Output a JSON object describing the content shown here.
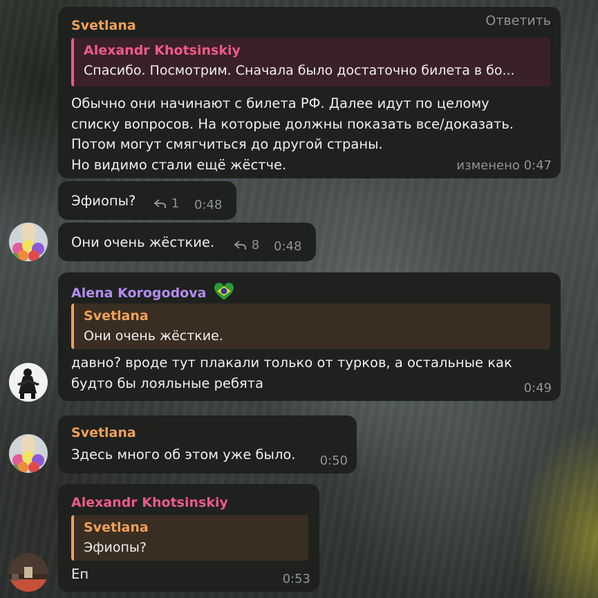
{
  "colors": {
    "bubble": "#1f211e",
    "svetlana": "#f0a05a",
    "alexandr": "#ef5a8a",
    "alena": "#b48cf0",
    "meta": "#8f9493"
  },
  "messages": [
    {
      "sender": "Svetlana",
      "reply_action": "Ответить",
      "quote": {
        "name": "Alexandr Khotsinskiy",
        "text": "Спасибо. Посмотрим. Сначала было достаточно билета в бо..."
      },
      "lines": [
        "Обычно они начинают с билета РФ. Далее идут по целому",
        "списку вопросов. На которые должны показать все/доказать.",
        "Потом могут смягчиться до другой страны.",
        "Но видимо стали ещё жёстче."
      ],
      "time": "изменено 0:47"
    },
    {
      "text": "Эфиопы?",
      "replies": "1",
      "time": "0:48"
    },
    {
      "text": "Они очень жёсткие.",
      "replies": "8",
      "time": "0:48"
    },
    {
      "sender": "Alena Korogodova",
      "sender_emoji": "brazil-heart",
      "quote": {
        "name": "Svetlana",
        "text": "Они очень жёсткие."
      },
      "lines": [
        "давно? вроде тут плакали только от турков, а остальные как",
        "будто бы лояльные ребята"
      ],
      "time": "0:49"
    },
    {
      "sender": "Svetlana",
      "text": "Здесь много об этом уже было.",
      "time": "0:50"
    },
    {
      "sender": "Alexandr Khotsinskiy",
      "quote": {
        "name": "Svetlana",
        "text": "Эфиопы?"
      },
      "text": "Еп",
      "time": "0:53"
    }
  ]
}
